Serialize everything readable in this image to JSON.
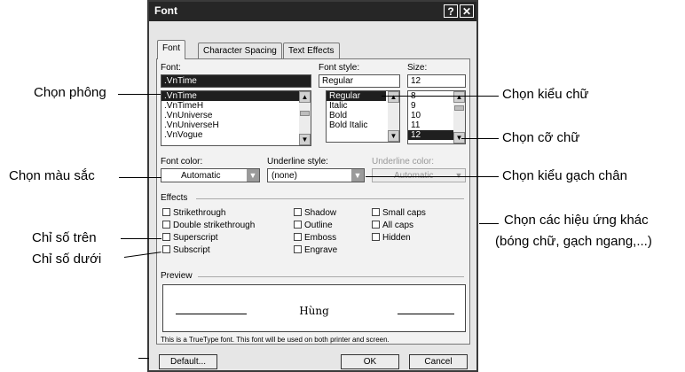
{
  "dialog": {
    "title": "Font",
    "help_glyph": "?",
    "close_glyph": "✕",
    "tabs": [
      {
        "label": "Font",
        "active": true
      },
      {
        "label": "Character Spacing",
        "active": false
      },
      {
        "label": "Text Effects",
        "active": false
      }
    ],
    "font": {
      "label": "Font:",
      "value": ".VnTime",
      "items": [
        ".VnTime",
        ".VnTimeH",
        ".VnUniverse",
        ".VnUniverseH",
        ".VnVogue"
      ],
      "selected": ".VnTime"
    },
    "font_style": {
      "label": "Font style:",
      "value": "Regular",
      "items": [
        "Regular",
        "Italic",
        "Bold",
        "Bold Italic"
      ],
      "selected": "Regular"
    },
    "size": {
      "label": "Size:",
      "value": "12",
      "items": [
        "8",
        "9",
        "10",
        "11",
        "12"
      ],
      "selected": "12"
    },
    "font_color": {
      "label": "Font color:",
      "value": "Automatic"
    },
    "underline_style": {
      "label": "Underline style:",
      "value": "(none)"
    },
    "underline_color": {
      "label": "Underline color:",
      "value": "Automatic"
    },
    "effects": {
      "label": "Effects",
      "col1": [
        "Strikethrough",
        "Double strikethrough",
        "Superscript",
        "Subscript"
      ],
      "col2": [
        "Shadow",
        "Outline",
        "Emboss",
        "Engrave"
      ],
      "col3": [
        "Small caps",
        "All caps",
        "Hidden"
      ]
    },
    "preview": {
      "label": "Preview",
      "text": "Hùng"
    },
    "info_text": "This is a TrueType font. This font will be used on both printer and screen.",
    "buttons": {
      "default": "Default...",
      "ok": "OK",
      "cancel": "Cancel"
    }
  },
  "annotations": {
    "chon_phong": "Chọn phông",
    "chon_mau_sac": "Chọn màu sắc",
    "chi_so_tren": "Chỉ số trên",
    "chi_so_duoi": "Chỉ số dưới",
    "chon_kieu_chu": "Chọn kiểu chữ",
    "chon_co_chu": "Chọn cỡ chữ",
    "chon_kieu_gach_chan": "Chọn kiểu gạch chân",
    "chon_hieu_ung_1": "Chọn các hiệu ứng khác",
    "chon_hieu_ung_2": "(bóng chữ, gạch ngang,...)"
  }
}
